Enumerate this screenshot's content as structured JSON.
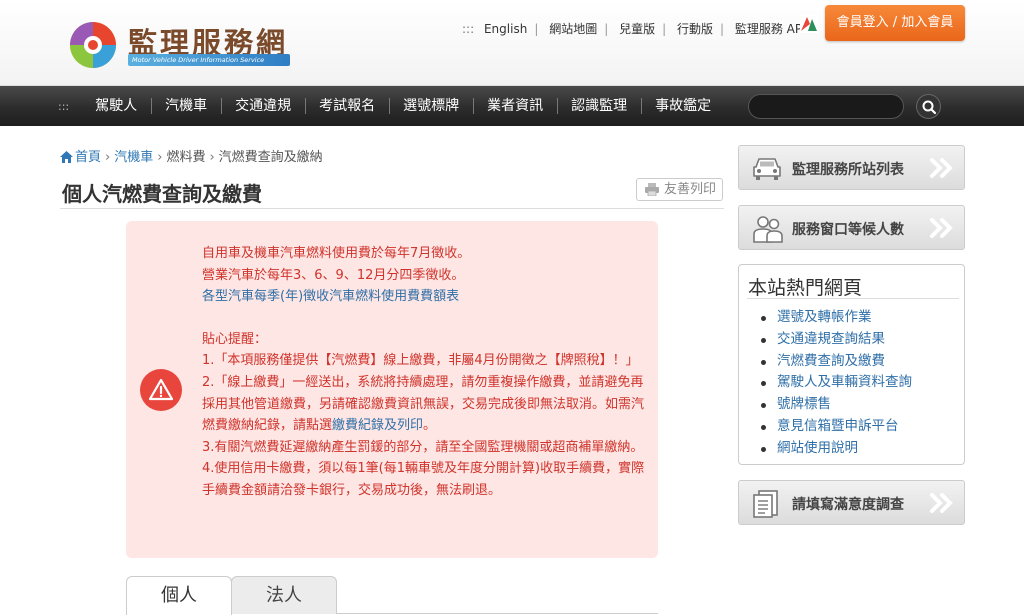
{
  "header": {
    "logo_title": "監理服務網",
    "logo_subtitle": "Motor Vehicle Driver Information Service",
    "top_dots": ":::",
    "top_links": [
      "English",
      "網站地圖",
      "兒童版",
      "行動版",
      "監理服務 APP"
    ],
    "login_label": "會員登入 / 加入會員"
  },
  "nav": {
    "dots": ":::",
    "items": [
      "駕駛人",
      "汽機車",
      "交通違規",
      "考試報名",
      "選號標牌",
      "業者資訊",
      "認識監理",
      "事故鑑定"
    ]
  },
  "breadcrumb": {
    "items": [
      "首頁",
      "汽機車",
      "燃料費",
      "汽燃費查詢及繳納"
    ],
    "separator": "›"
  },
  "page": {
    "title": "個人汽燃費查詢及繳費",
    "print_label": "友善列印"
  },
  "notice": {
    "lines": [
      "自用車及機車汽車燃料使用費於每年7月徵收。",
      "營業汽車於每年3、6、9、12月分四季徵收。"
    ],
    "link": "各型汽車每季(年)徵收汽車燃料使用費費額表",
    "reminder_title": "貼心提醒：",
    "items": [
      "1.「本項服務僅提供【汽燃費】線上繳費，非屬4月份開徵之【牌照稅】！」",
      "2.「線上繳費」一經送出，系統將持續處理，請勿重複操作繳費，並請避免再採用其他管道繳費，另請確認繳費資訊無誤，交易完成後即無法取消。如需汽燃費繳納紀錄，請點選",
      "3.有關汽燃費延遲繳納產生罰鍰的部分，請至全國監理機關或超商補單繳納。",
      "4.使用信用卡繳費，須以每1筆(每1輛車號及年度分開計算)收取手續費，實際手續費金額請洽發卡銀行，交易成功後，無法刷退。"
    ],
    "item2_link": "繳費紀錄及列印",
    "item2_end": "。"
  },
  "tabs": [
    "個人",
    "法人"
  ],
  "sidebar": {
    "station_list": "監理服務所站列表",
    "waiting": "服務窗口等候人數",
    "hot_title": "本站熱門網頁",
    "hot_links": [
      "選號及轉帳作業",
      "交通違規查詢結果",
      "汽燃費查詢及繳費",
      "駕駛人及車輛資料查詢",
      "號牌標售",
      "意見信箱暨申訴平台",
      "網站使用說明"
    ],
    "survey": "請填寫滿意度調查"
  }
}
